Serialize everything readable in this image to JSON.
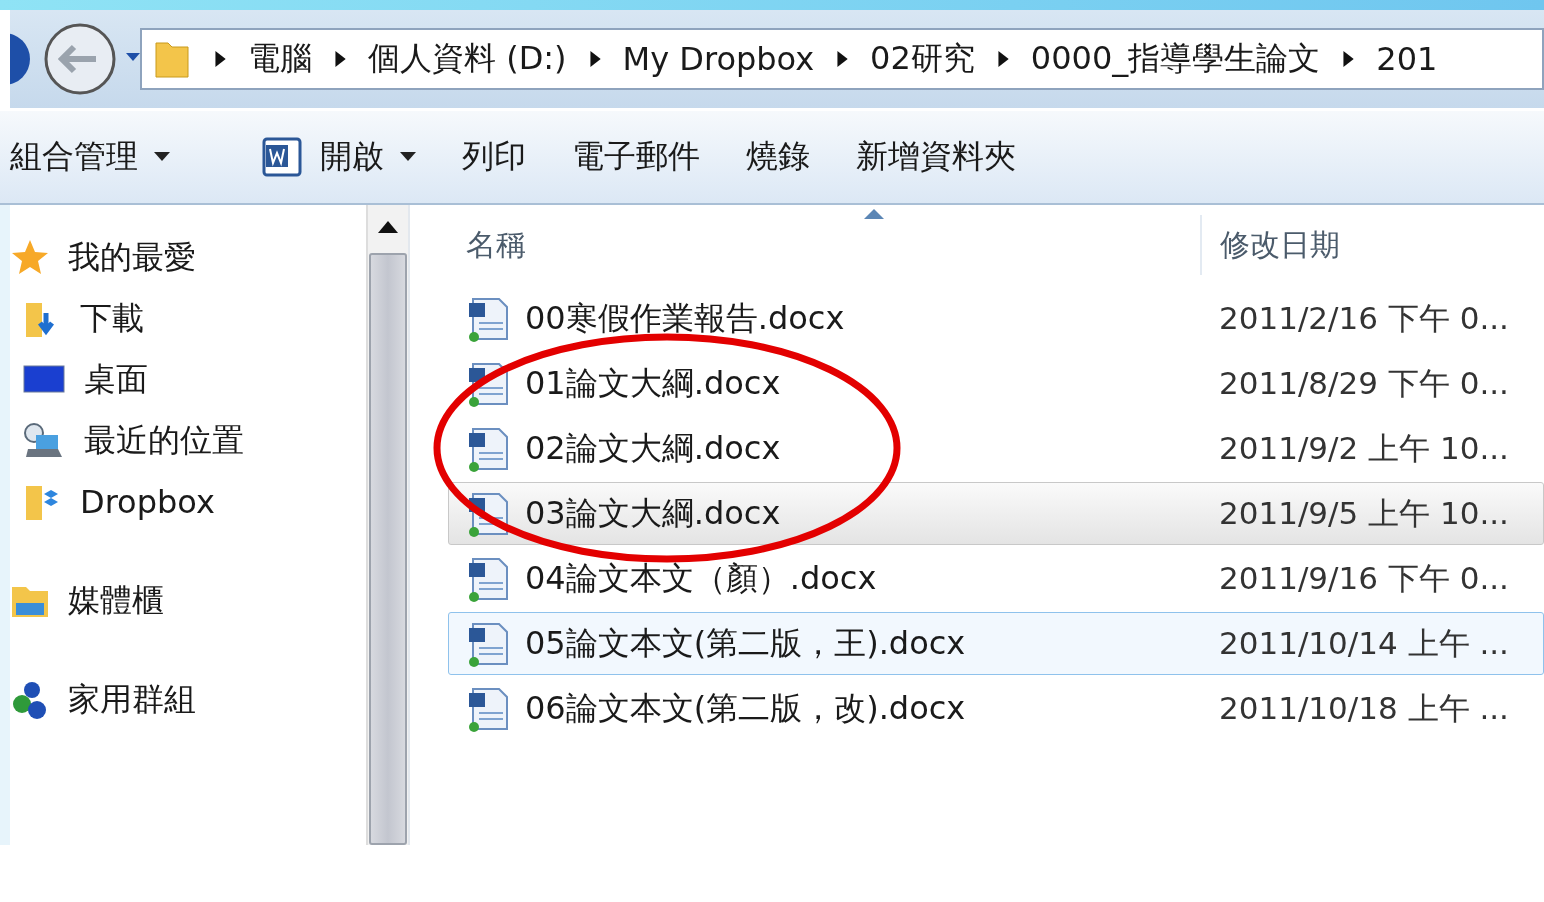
{
  "address_bar": {
    "crumbs": [
      "電腦",
      "個人資料 (D:)",
      "My Dropbox",
      "02研究",
      "0000_指導學生論文",
      "201"
    ]
  },
  "toolbar": {
    "items": [
      {
        "label": "組合管理",
        "kind": "dropdown"
      },
      {
        "label": "開啟",
        "kind": "word-dropdown"
      },
      {
        "label": "列印",
        "kind": "plain"
      },
      {
        "label": "電子郵件",
        "kind": "plain"
      },
      {
        "label": "燒錄",
        "kind": "plain"
      },
      {
        "label": "新增資料夾",
        "kind": "plain"
      }
    ]
  },
  "sidebar": {
    "groups": [
      {
        "label": "我的最愛",
        "kind": "star",
        "children": [
          {
            "label": "下載",
            "kind": "download"
          },
          {
            "label": "桌面",
            "kind": "desktop"
          },
          {
            "label": "最近的位置",
            "kind": "recent"
          },
          {
            "label": "Dropbox",
            "kind": "dropbox"
          }
        ]
      },
      {
        "label": "媒體櫃",
        "kind": "library"
      },
      {
        "label": "家用群組",
        "kind": "homegroup"
      }
    ]
  },
  "file_list": {
    "columns": [
      "名稱",
      "修改日期"
    ],
    "rows": [
      {
        "name": "00寒假作業報告.docx",
        "modified": "2011/2/16 下午 0...",
        "hovered": false,
        "selected": false
      },
      {
        "name": "01論文大綱.docx",
        "modified": "2011/8/29 下午 0...",
        "hovered": false,
        "selected": false
      },
      {
        "name": "02論文大綱.docx",
        "modified": "2011/9/2 上午 10...",
        "hovered": false,
        "selected": false
      },
      {
        "name": "03論文大綱.docx",
        "modified": "2011/9/5 上午 10...",
        "hovered": true,
        "selected": false
      },
      {
        "name": "04論文本文（顏）.docx",
        "modified": "2011/9/16 下午 0...",
        "hovered": false,
        "selected": false
      },
      {
        "name": "05論文本文(第二版，王).docx",
        "modified": "2011/10/14 上午 ...",
        "hovered": false,
        "selected": true
      },
      {
        "name": "06論文本文(第二版，改).docx",
        "modified": "2011/10/18 上午 ...",
        "hovered": false,
        "selected": false
      }
    ]
  }
}
